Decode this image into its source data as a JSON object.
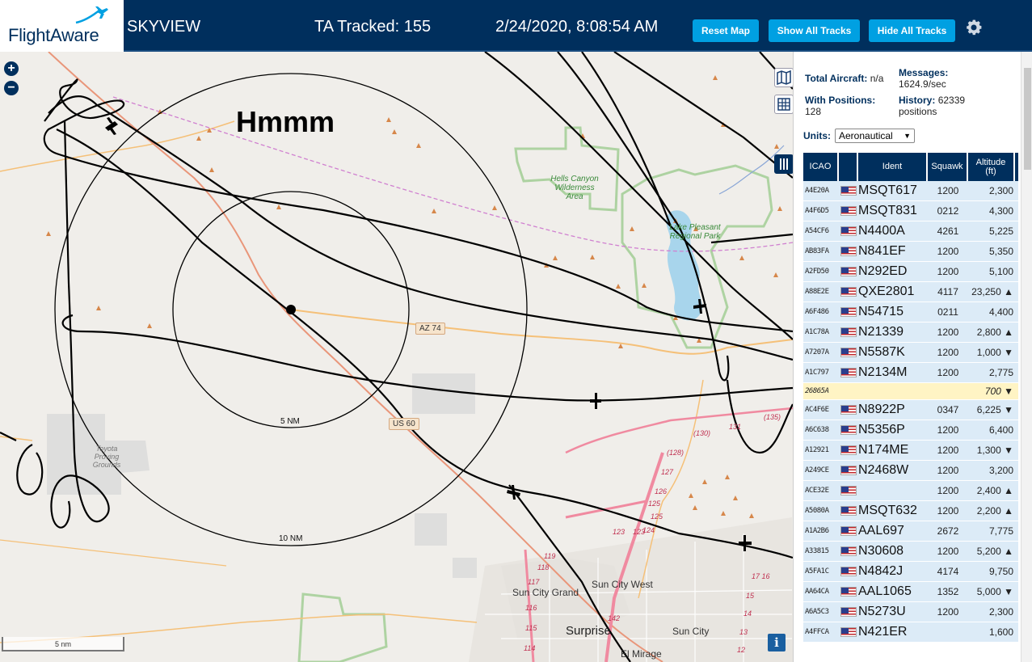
{
  "header": {
    "brand": "FlightAware",
    "site_name": "SKYVIEW",
    "tracked": "TA Tracked: 155",
    "clock": "2/24/2020, 8:08:54 AM",
    "buttons": {
      "reset": "Reset Map",
      "show": "Show All Tracks",
      "hide": "Hide All Tracks"
    },
    "settings_icon": "gear-icon"
  },
  "map": {
    "zoom_in": "+",
    "zoom_out": "−",
    "overlay_text": "Hmmm",
    "rings": {
      "inner": "5 NM",
      "outer": "10 NM"
    },
    "scale": "5 nm",
    "info": "i",
    "labels": {
      "hells_canyon": "Hells Canyon Wilderness Area",
      "lake_pleasant": "Lake Pleasant Regional Park",
      "toyota": "Toyota Proving Grounds",
      "sun_city_grand": "Sun City Grand",
      "sun_city_west": "Sun City West",
      "surprise": "Surprise",
      "sun_city": "Sun City",
      "el_mirage": "El Mirage",
      "az74": "AZ 74",
      "us60": "US 60",
      "r131": "131",
      "r135": "(135)",
      "r130": "(130)",
      "r128": "(128)",
      "r127": "127",
      "r126": "126",
      "r125a": "125",
      "r125b": "125",
      "r124": "124",
      "r123a": "123",
      "r123b": "123",
      "r119": "119",
      "r118": "118",
      "r117": "117",
      "r116": "116",
      "r115": "115",
      "r114": "114",
      "r142": "142",
      "r1716": "17 16",
      "r15": "15",
      "r14": "14",
      "r13": "13",
      "r12": "12"
    }
  },
  "sidebar": {
    "total_label": "Total Aircraft:",
    "total_value": "n/a",
    "messages_label": "Messages:",
    "messages_value": "1624.9/sec",
    "positions_label": "With Positions:",
    "positions_value": "128",
    "history_label": "History:",
    "history_value": "62339",
    "history_unit": "positions",
    "units_label": "Units:",
    "units_value": "Aeronautical",
    "columns": {
      "icao": "ICAO",
      "ident": "Ident",
      "squawk": "Squawk",
      "alt1": "Altitude",
      "alt2": "(ft)"
    },
    "rows": [
      {
        "icao": "A4E20A",
        "flag": true,
        "ident": "MSQT617",
        "squawk": "1200",
        "alt": "2,300"
      },
      {
        "icao": "A4F6D5",
        "flag": true,
        "ident": "MSQT831",
        "squawk": "0212",
        "alt": "4,300"
      },
      {
        "icao": "A54CF6",
        "flag": true,
        "ident": "N4400A",
        "squawk": "4261",
        "alt": "5,225"
      },
      {
        "icao": "AB83FA",
        "flag": true,
        "ident": "N841EF",
        "squawk": "1200",
        "alt": "5,350"
      },
      {
        "icao": "A2FD50",
        "flag": true,
        "ident": "N292ED",
        "squawk": "1200",
        "alt": "5,100"
      },
      {
        "icao": "A88E2E",
        "flag": true,
        "ident": "QXE2801",
        "squawk": "4117",
        "alt": "23,250 ▲"
      },
      {
        "icao": "A6F486",
        "flag": true,
        "ident": "N54715",
        "squawk": "0211",
        "alt": "4,400"
      },
      {
        "icao": "A1C78A",
        "flag": true,
        "ident": "N21339",
        "squawk": "1200",
        "alt": "2,800 ▲"
      },
      {
        "icao": "A7207A",
        "flag": true,
        "ident": "N5587K",
        "squawk": "1200",
        "alt": "1,000 ▼"
      },
      {
        "icao": "A1C797",
        "flag": true,
        "ident": "N2134M",
        "squawk": "1200",
        "alt": "2,775"
      },
      {
        "icao": "26865A",
        "flag": false,
        "ident": "",
        "squawk": "",
        "alt": "700 ▼",
        "highlight": true
      },
      {
        "icao": "AC4F6E",
        "flag": true,
        "ident": "N8922P",
        "squawk": "0347",
        "alt": "6,225 ▼"
      },
      {
        "icao": "A6C638",
        "flag": true,
        "ident": "N5356P",
        "squawk": "1200",
        "alt": "6,400"
      },
      {
        "icao": "A12921",
        "flag": true,
        "ident": "N174ME",
        "squawk": "1200",
        "alt": "1,300 ▼"
      },
      {
        "icao": "A249CE",
        "flag": true,
        "ident": "N2468W",
        "squawk": "1200",
        "alt": "3,200"
      },
      {
        "icao": "ACE32E",
        "flag": true,
        "ident": "",
        "squawk": "1200",
        "alt": "2,400 ▲"
      },
      {
        "icao": "A5080A",
        "flag": true,
        "ident": "MSQT632",
        "squawk": "1200",
        "alt": "2,200 ▲"
      },
      {
        "icao": "A1A2B6",
        "flag": true,
        "ident": "AAL697",
        "squawk": "2672",
        "alt": "7,775"
      },
      {
        "icao": "A33815",
        "flag": true,
        "ident": "N30608",
        "squawk": "1200",
        "alt": "5,200 ▲"
      },
      {
        "icao": "A5FA1C",
        "flag": true,
        "ident": "N4842J",
        "squawk": "4174",
        "alt": "9,750"
      },
      {
        "icao": "AA64CA",
        "flag": true,
        "ident": "AAL1065",
        "squawk": "1352",
        "alt": "5,000 ▼"
      },
      {
        "icao": "A6A5C3",
        "flag": true,
        "ident": "N5273U",
        "squawk": "1200",
        "alt": "2,300"
      },
      {
        "icao": "A4FFCA",
        "flag": true,
        "ident": "N421ER",
        "squawk": "",
        "alt": "1,600"
      }
    ]
  }
}
